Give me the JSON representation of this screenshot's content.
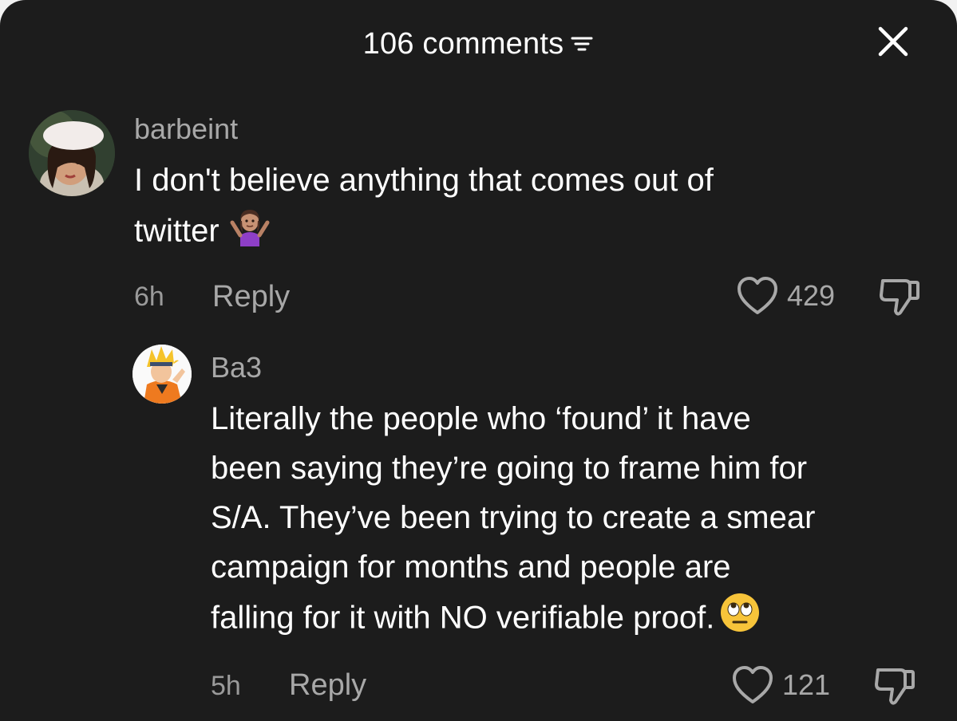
{
  "header": {
    "title": "106 comments",
    "sort_icon": "sort-lines-icon",
    "close_icon": "close-x-icon"
  },
  "comments": [
    {
      "username": "barbeint",
      "text_lines": [
        "I don't believe anything that comes out of",
        "twitter"
      ],
      "emoji": "person-shrugging",
      "time": "6h",
      "reply_label": "Reply",
      "likes": "429",
      "avatar": "woman-in-white-beret"
    },
    {
      "username": "Ba3",
      "text_lines": [
        "Literally the people who ‘found’ it have",
        "been saying they’re going to frame him for",
        "S/A. They’ve been trying to create a smear",
        "campaign for months and people are",
        "falling for it with NO verifiable proof."
      ],
      "emoji": "face-with-rolling-eyes",
      "time": "5h",
      "reply_label": "Reply",
      "likes": "121",
      "avatar": "anime-character-orange"
    }
  ],
  "colors": {
    "background": "#1c1c1c",
    "text_primary": "#ffffff",
    "text_secondary": "#a8a8a8"
  }
}
